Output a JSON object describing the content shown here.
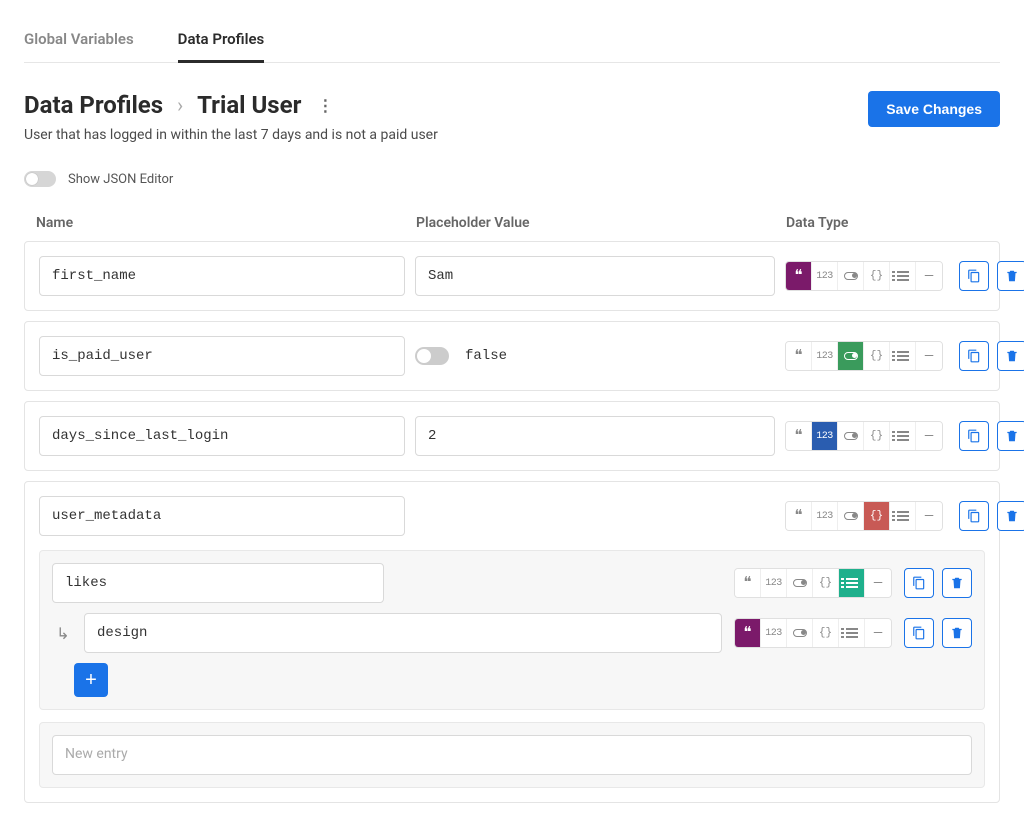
{
  "tabs": {
    "global_variables": "Global Variables",
    "data_profiles": "Data Profiles"
  },
  "breadcrumb": {
    "root": "Data Profiles",
    "current": "Trial User"
  },
  "description": "User that has logged in within the last 7 days and is not a paid user",
  "save_button": "Save Changes",
  "json_toggle_label": "Show JSON Editor",
  "columns": {
    "name": "Name",
    "placeholder_value": "Placeholder Value",
    "data_type": "Data Type"
  },
  "type_labels": {
    "string": "string",
    "number": "number",
    "boolean": "boolean",
    "object": "object",
    "array": "array",
    "null": "null"
  },
  "rows": [
    {
      "name": "first_name",
      "value": "Sam",
      "type": "string"
    },
    {
      "name": "is_paid_user",
      "bool_display": "false",
      "type": "boolean"
    },
    {
      "name": "days_since_last_login",
      "value": "2",
      "type": "number"
    },
    {
      "name": "user_metadata",
      "type": "object",
      "children": [
        {
          "name": "likes",
          "type": "array",
          "items": [
            {
              "value": "design",
              "type": "string"
            }
          ]
        }
      ]
    }
  ],
  "new_entry_placeholder": "New entry"
}
